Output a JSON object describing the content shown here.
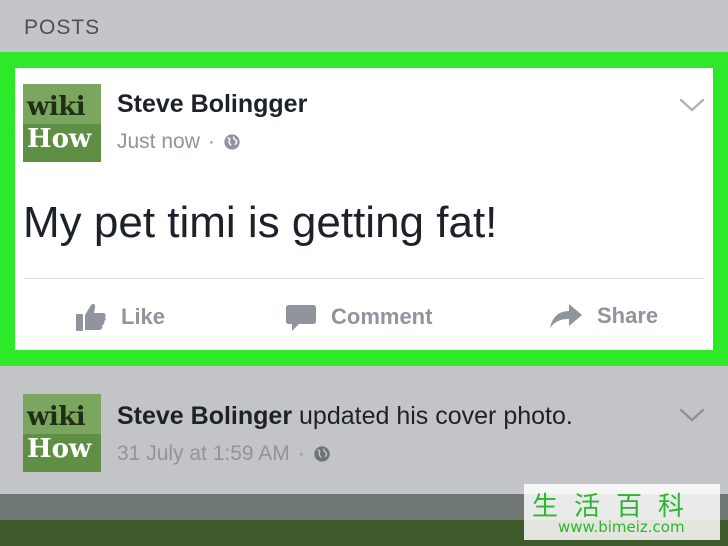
{
  "section": {
    "title": "POSTS"
  },
  "post1": {
    "avatar": {
      "line1": "wiki",
      "line2": "How"
    },
    "author": "Steve Bolingger",
    "time": "Just now",
    "separator": "·",
    "text": "My pet timi is getting fat!",
    "actions": {
      "like": "Like",
      "comment": "Comment",
      "share": "Share"
    }
  },
  "post2": {
    "avatar": {
      "line1": "wiki",
      "line2": "How"
    },
    "author": "Steve Bolinger",
    "action_text": "updated his cover photo.",
    "time": "31 July at 1:59 AM",
    "separator": "·"
  },
  "watermark": {
    "chinese": "生活百科",
    "url": "www.bimeiz.com"
  },
  "colors": {
    "highlight": "#2ee82a",
    "text": "#1d2129",
    "muted": "#90949c"
  },
  "icons": {
    "audience": "globe-icon",
    "menu": "chevron-down-icon",
    "like": "thumbs-up-icon",
    "comment": "comment-bubble-icon",
    "share": "share-arrow-icon"
  }
}
